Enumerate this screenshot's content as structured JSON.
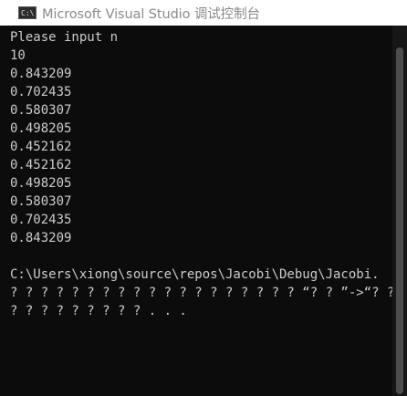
{
  "window": {
    "title": "Microsoft Visual Studio 调试控制台",
    "icon": "console-icon"
  },
  "console": {
    "lines": [
      "Please input n",
      "10",
      "0.843209",
      "0.702435",
      "0.580307",
      "0.498205",
      "0.452162",
      "0.452162",
      "0.498205",
      "0.580307",
      "0.702435",
      "0.843209",
      "",
      "C:\\Users\\xiong\\source\\repos\\Jacobi\\Debug\\Jacobi.",
      "? ? ? ? ? ? ? ? ? ? ? ? ? ? ? ? ? ? ? “? ? ”->“? ?",
      "? ? ? ? ? ? ? ? ? . . ."
    ]
  },
  "colors": {
    "background": "#0c0c0c",
    "text": "#cccccc",
    "titlebar": "#ffffff"
  }
}
